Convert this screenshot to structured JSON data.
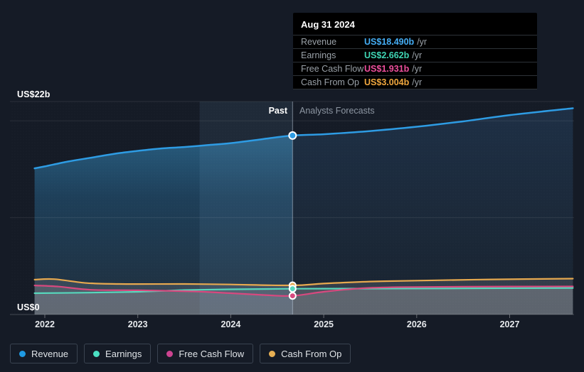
{
  "page": {
    "background": "#151b26"
  },
  "axis": {
    "y_top_label": "US$22b",
    "y_bottom_label": "US$0",
    "years": [
      2022,
      2023,
      2024,
      2025,
      2026,
      2027
    ]
  },
  "annotations": {
    "past_label": "Past",
    "forecast_label": "Analysts Forecasts"
  },
  "tooltip": {
    "date": "Aug 31 2024",
    "rows": [
      {
        "label": "Revenue",
        "value": "US$18.490b",
        "unit": "/yr",
        "color": "#45aef5"
      },
      {
        "label": "Earnings",
        "value": "US$2.662b",
        "unit": "/yr",
        "color": "#3fd6b4"
      },
      {
        "label": "Free Cash Flow",
        "value": "US$1.931b",
        "unit": "/yr",
        "color": "#ef4f9d"
      },
      {
        "label": "Cash From Op",
        "value": "US$3.004b",
        "unit": "/yr",
        "color": "#f0a73e"
      }
    ]
  },
  "legend": [
    {
      "label": "Revenue",
      "color": "#1f9ae3"
    },
    {
      "label": "Earnings",
      "color": "#4be0c3"
    },
    {
      "label": "Free Cash Flow",
      "color": "#cc4390"
    },
    {
      "label": "Cash From Op",
      "color": "#e8b054"
    }
  ],
  "chart_data": {
    "type": "line",
    "title": "Earnings and Revenue Growth",
    "x_unit": "year (fractional)",
    "y_unit": "US$ billions",
    "ylim": [
      0,
      22
    ],
    "xlim": [
      2021.85,
      2027.72
    ],
    "gridline_values": [
      22,
      20,
      10
    ],
    "divider_x": 2024.665,
    "divider_date": "Aug 31 2024",
    "highlight_band": [
      2023.665,
      2024.665
    ],
    "legend_position": "bottom-left",
    "series": [
      {
        "name": "Revenue",
        "color": "#2e9ce4",
        "points": [
          [
            2021.89,
            15.1
          ],
          [
            2022.0,
            15.3
          ],
          [
            2022.25,
            15.8
          ],
          [
            2022.5,
            16.2
          ],
          [
            2022.75,
            16.6
          ],
          [
            2023.0,
            16.9
          ],
          [
            2023.25,
            17.15
          ],
          [
            2023.5,
            17.3
          ],
          [
            2023.75,
            17.5
          ],
          [
            2024.0,
            17.7
          ],
          [
            2024.33,
            18.1
          ],
          [
            2024.665,
            18.49
          ],
          [
            2025.0,
            18.62
          ],
          [
            2025.5,
            18.95
          ],
          [
            2026.0,
            19.4
          ],
          [
            2026.5,
            19.95
          ],
          [
            2027.0,
            20.6
          ],
          [
            2027.68,
            21.3
          ]
        ],
        "marker_value_at_divider": 18.49,
        "line_width": 2.5,
        "marker_r": 5,
        "fill": "revenue"
      },
      {
        "name": "Cash From Op",
        "color": "#e7a94f",
        "points": [
          [
            2021.89,
            3.6
          ],
          [
            2022.1,
            3.65
          ],
          [
            2022.45,
            3.25
          ],
          [
            2022.8,
            3.15
          ],
          [
            2023.5,
            3.15
          ],
          [
            2024.0,
            3.1
          ],
          [
            2024.665,
            3.004
          ],
          [
            2025.0,
            3.2
          ],
          [
            2025.5,
            3.4
          ],
          [
            2026.0,
            3.5
          ],
          [
            2026.8,
            3.62
          ],
          [
            2027.68,
            3.7
          ]
        ],
        "marker_value_at_divider": 3.004,
        "line_width": 2.2,
        "marker_r": 4.5,
        "fill": "gray",
        "fill_alpha": 0.22
      },
      {
        "name": "Earnings",
        "color": "#57d8bd",
        "points": [
          [
            2021.89,
            2.2
          ],
          [
            2022.5,
            2.26
          ],
          [
            2023.0,
            2.35
          ],
          [
            2023.5,
            2.52
          ],
          [
            2024.0,
            2.6
          ],
          [
            2024.665,
            2.662
          ],
          [
            2025.5,
            2.68
          ],
          [
            2026.5,
            2.7
          ],
          [
            2027.68,
            2.74
          ]
        ],
        "marker_value_at_divider": 2.662,
        "line_width": 2.2,
        "marker_r": 4.5,
        "fill": "gray",
        "fill_alpha": 0.26
      },
      {
        "name": "Free Cash Flow",
        "color": "#d7497f",
        "points": [
          [
            2021.89,
            3.0
          ],
          [
            2022.15,
            2.88
          ],
          [
            2022.5,
            2.55
          ],
          [
            2023.0,
            2.5
          ],
          [
            2023.6,
            2.38
          ],
          [
            2024.0,
            2.2
          ],
          [
            2024.35,
            2.02
          ],
          [
            2024.665,
            1.931
          ],
          [
            2025.0,
            2.35
          ],
          [
            2025.4,
            2.7
          ],
          [
            2025.8,
            2.82
          ],
          [
            2026.5,
            2.87
          ],
          [
            2027.68,
            2.9
          ]
        ],
        "marker_value_at_divider": 1.931,
        "line_width": 2.2,
        "marker_r": 4.5,
        "fill": "gray",
        "fill_alpha": 0.26
      }
    ]
  }
}
